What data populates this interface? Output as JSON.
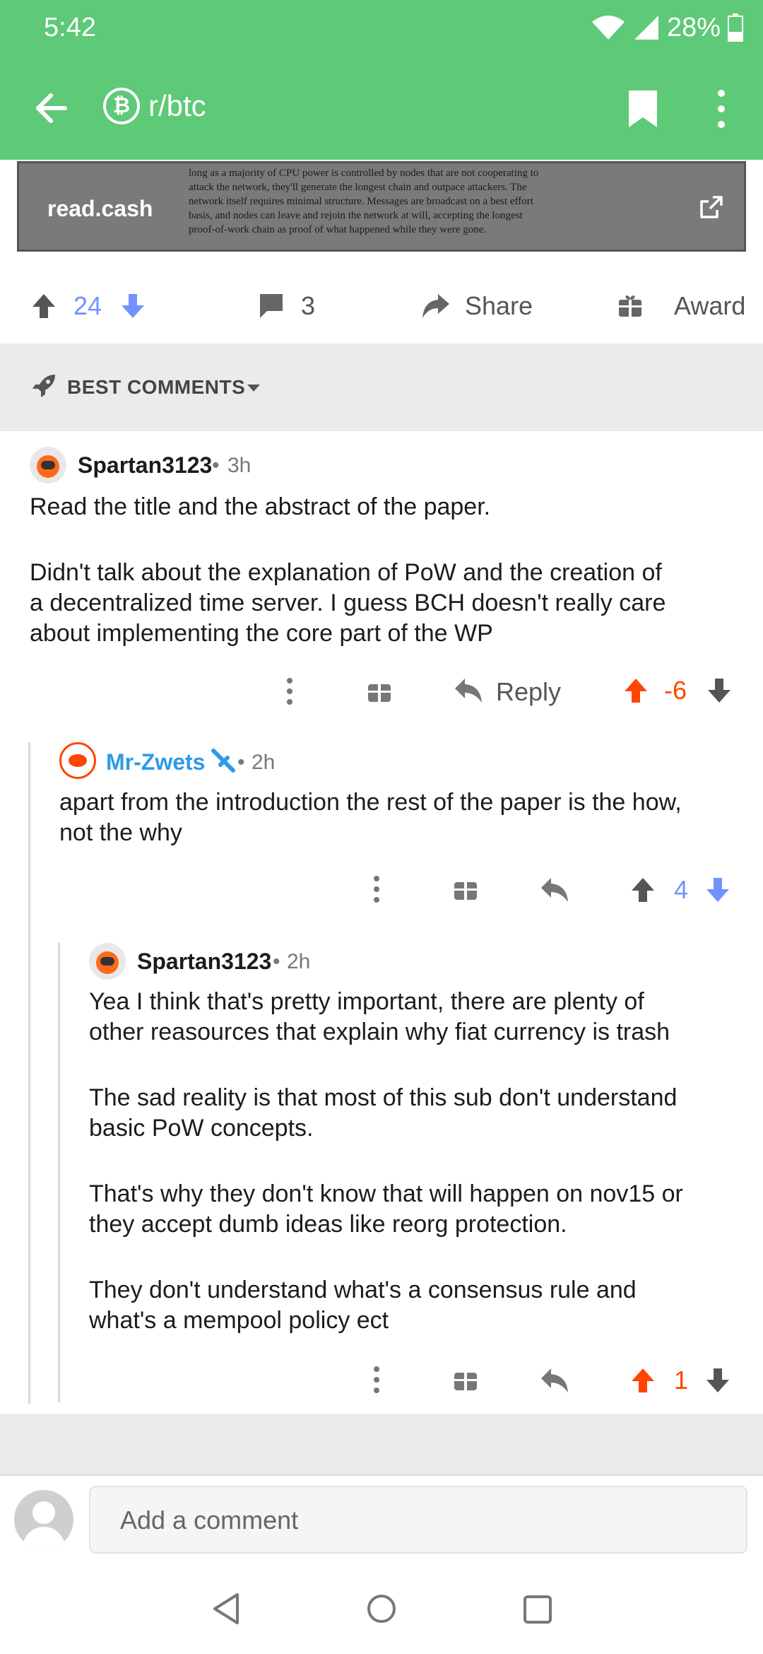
{
  "status_bar": {
    "time": "5:42",
    "battery": "28%"
  },
  "app_bar": {
    "subreddit": "r/btc",
    "subreddit_icon": "bitcoin-icon"
  },
  "link_card": {
    "domain": "read.cash",
    "preview_lines": [
      "long as a majority of CPU power is controlled by nodes that are not cooperating to",
      "attack the network, they'll generate the longest chain and outpace attackers.  The",
      "network itself requires minimal structure.  Messages are broadcast on a best effort",
      "basis, and nodes can leave and rejoin the network at will, accepting the longest",
      "proof-of-work chain as proof of what happened while they were gone."
    ]
  },
  "post_actions": {
    "score": "24",
    "comments": "3",
    "share": "Share",
    "award": "Award"
  },
  "sort": {
    "label": "BEST COMMENTS"
  },
  "comments": [
    {
      "author": "Spartan3123",
      "time": "3h",
      "body_p1": "Read the title and the abstract of the paper.",
      "body_p2_l1": "Didn't talk about the explanation of PoW and the creation of",
      "body_p2_l2": "a decentralized time server. I guess BCH doesn't really care",
      "body_p2_l3": "about implementing the core part of the WP",
      "reply": "Reply",
      "score": "-6"
    },
    {
      "author": "Mr-Zwets",
      "time": "2h",
      "body_l1": "apart from the introduction the rest of the paper is the how,",
      "body_l2": "not the why",
      "score": "4"
    },
    {
      "author": "Spartan3123",
      "time": "2h",
      "p1_l1": "Yea I think that's pretty important, there are plenty of",
      "p1_l2": "other reasources that explain why fiat currency is trash",
      "p2_l1": "The sad reality is that most of this sub don't understand",
      "p2_l2": "basic PoW concepts.",
      "p3_l1": "That's why they don't know that will happen on nov15 or",
      "p3_l2": "they accept dumb ideas like reorg protection.",
      "p4_l1": "They don't understand what's a consensus rule and",
      "p4_l2": "what's a mempool policy ect",
      "score": "1"
    }
  ],
  "comment_bar": {
    "placeholder": "Add a comment"
  },
  "colors": {
    "header_green": "#5ec977",
    "upvote_orange": "#ff4500",
    "downvote_blue": "#7193ff",
    "mod_blue": "#2e9ae8"
  }
}
